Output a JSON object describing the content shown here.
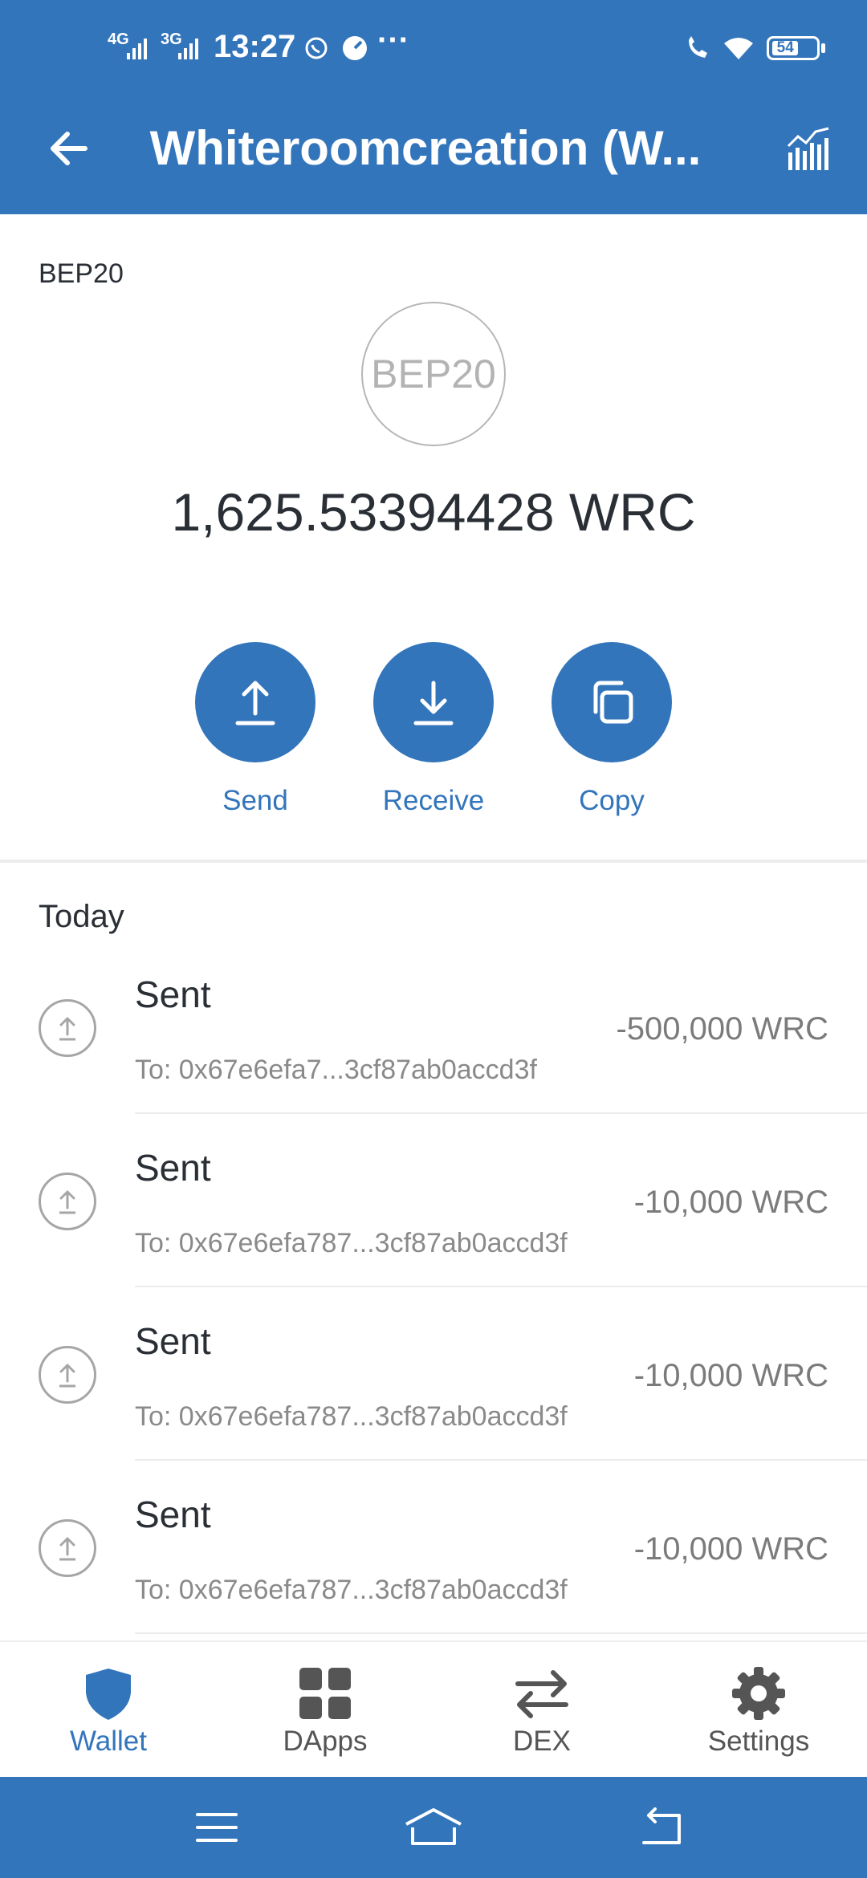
{
  "status_bar": {
    "net1": "4G",
    "net2": "3G",
    "time": "13:27",
    "overflow": "···",
    "battery": "54"
  },
  "appbar": {
    "title": "Whiteroomcreation (W...",
    "back_icon": "arrow-left-icon",
    "chart_icon": "bar-chart-icon"
  },
  "token": {
    "network": "BEP20",
    "logo_text": "BEP20",
    "balance": "1,625.53394428 WRC"
  },
  "actions": {
    "send": "Send",
    "receive": "Receive",
    "copy": "Copy"
  },
  "transactions": {
    "section_title": "Today",
    "items": [
      {
        "title": "Sent",
        "to": "To: 0x67e6efa7...3cf87ab0accd3f",
        "amount": "-500,000 WRC"
      },
      {
        "title": "Sent",
        "to": "To: 0x67e6efa787...3cf87ab0accd3f",
        "amount": "-10,000 WRC"
      },
      {
        "title": "Sent",
        "to": "To: 0x67e6efa787...3cf87ab0accd3f",
        "amount": "-10,000 WRC"
      },
      {
        "title": "Sent",
        "to": "To: 0x67e6efa787...3cf87ab0accd3f",
        "amount": "-10,000 WRC"
      }
    ]
  },
  "bottom_nav": {
    "items": [
      {
        "label": "Wallet",
        "icon": "shield-icon",
        "active": true
      },
      {
        "label": "DApps",
        "icon": "grid-icon",
        "active": false
      },
      {
        "label": "DEX",
        "icon": "swap-arrows-icon",
        "active": false
      },
      {
        "label": "Settings",
        "icon": "gear-icon",
        "active": false
      }
    ]
  },
  "colors": {
    "brand": "#3375bb",
    "text": "#2a2f36",
    "muted": "#8a8a8a"
  }
}
